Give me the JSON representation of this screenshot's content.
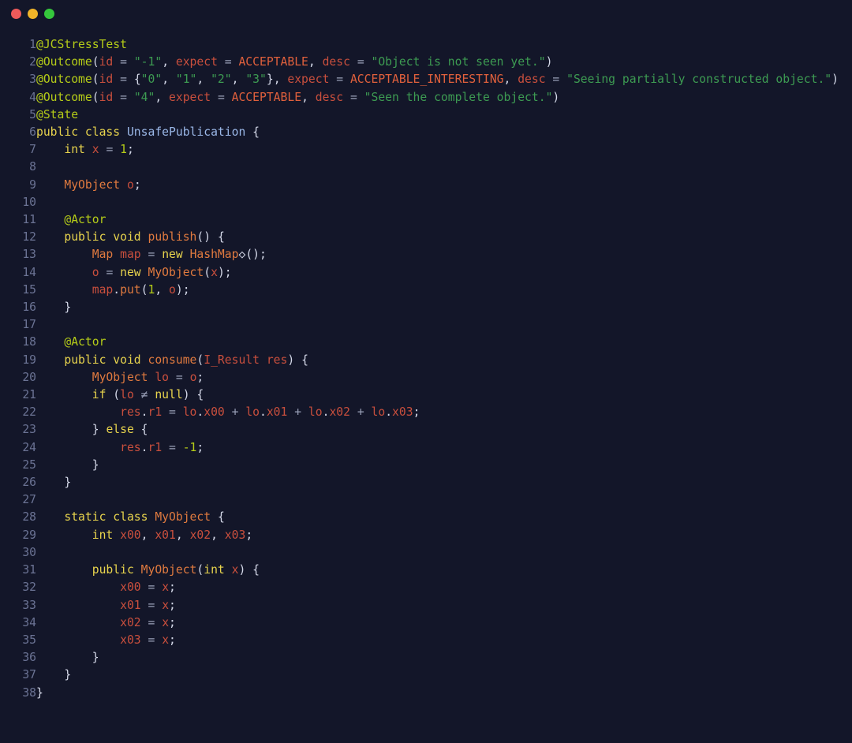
{
  "window": {
    "controls": [
      {
        "name": "close",
        "color": "#ef5a5a"
      },
      {
        "name": "minimize",
        "color": "#f0b429"
      },
      {
        "name": "maximize",
        "color": "#35c73c"
      }
    ],
    "background": "#131629",
    "gutter_color": "#6b7394"
  },
  "editor": {
    "language": "java",
    "line_count": 38,
    "line_numbers": [
      "1",
      "2",
      "3",
      "4",
      "5",
      "6",
      "7",
      "8",
      "9",
      "10",
      "11",
      "12",
      "13",
      "14",
      "15",
      "16",
      "17",
      "18",
      "19",
      "20",
      "21",
      "22",
      "23",
      "24",
      "25",
      "26",
      "27",
      "28",
      "29",
      "30",
      "31",
      "32",
      "33",
      "34",
      "35",
      "36",
      "37",
      "38"
    ],
    "lines": [
      "@JCStressTest",
      "@Outcome(id = \"-1\", expect = ACCEPTABLE, desc = \"Object is not seen yet.\")",
      "@Outcome(id = {\"0\", \"1\", \"2\", \"3\"}, expect = ACCEPTABLE_INTERESTING, desc = \"Seeing partially constructed object.\")",
      "@Outcome(id = \"4\", expect = ACCEPTABLE, desc = \"Seen the complete object.\")",
      "@State",
      "public class UnsafePublication {",
      "    int x = 1;",
      "",
      "    MyObject o;",
      "",
      "    @Actor",
      "    public void publish() {",
      "        Map map = new HashMap<>();",
      "        o = new MyObject(x);",
      "        map.put(1, o);",
      "    }",
      "",
      "    @Actor",
      "    public void consume(I_Result res) {",
      "        MyObject lo = o;",
      "        if (lo != null) {",
      "            res.r1 = lo.x00 + lo.x01 + lo.x02 + lo.x03;",
      "        } else {",
      "            res.r1 = -1;",
      "        }",
      "    }",
      "",
      "    static class MyObject {",
      "        int x00, x01, x02, x03;",
      "",
      "        public MyObject(int x) {",
      "            x00 = x;",
      "            x01 = x;",
      "            x02 = x;",
      "            x03 = x;",
      "        }",
      "    }",
      "}"
    ],
    "colors": {
      "annotation": "#b5cc18",
      "keyword": "#e8d44d",
      "type_declaration": "#9bb8e8",
      "class_reference": "#e07a3f",
      "method": "#e07a3f",
      "identifier": "#c94f3d",
      "string": "#3d9b52",
      "number": "#b5cc18",
      "enum_constant": "#e0603c",
      "punctuation": "#d4d8e8",
      "operator": "#9aa0b8"
    },
    "ligatures": {
      "diamond": "◇",
      "not_equal": "≠"
    }
  }
}
